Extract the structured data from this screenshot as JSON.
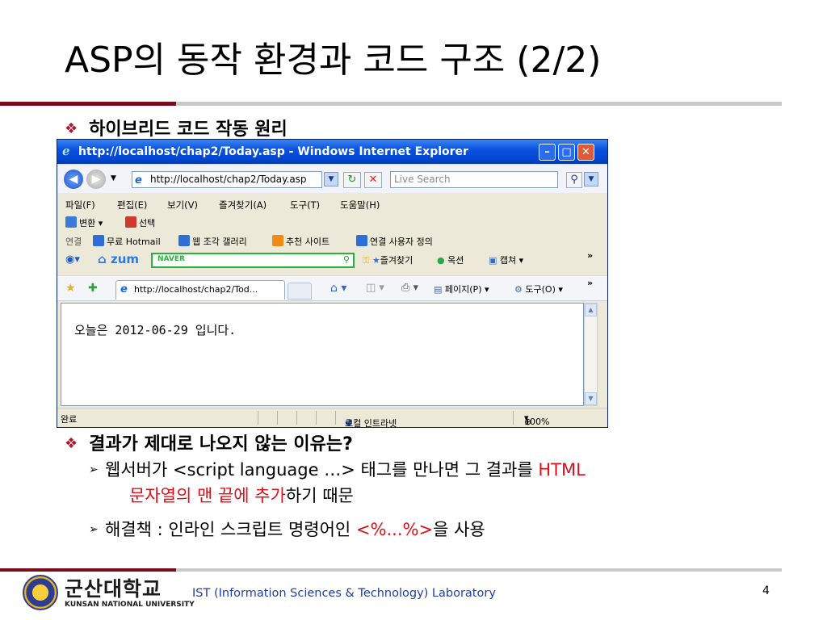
{
  "slide": {
    "title": "ASP의 동작 환경과 코드 구조 (2/2)",
    "bullets": [
      {
        "text": "하이브리드 코드 작동 원리"
      },
      {
        "text": "결과가 제대로 나오지 않는 이유는?"
      }
    ],
    "sub": {
      "line1_prefix": "웹서버가 <script language …> 태그를 만나면 그 결과를 ",
      "line1_red": "HTML",
      "line2_red": "문자열의 맨 끝에 추가",
      "line2_suffix": "하기 때문",
      "line3_prefix": "해결책 : 인라인 스크립트 명령어인 ",
      "line3_red": "<%...%>",
      "line3_suffix": "을 사용"
    }
  },
  "browser": {
    "title": "http://localhost/chap2/Today.asp - Windows Internet Explorer",
    "address": "http://localhost/chap2/Today.asp",
    "search_placeholder": "Live Search",
    "menu": [
      "파일(F)",
      "편집(E)",
      "보기(V)",
      "즐겨찾기(A)",
      "도구(T)",
      "도움말(H)"
    ],
    "translate": [
      "변환",
      "선택"
    ],
    "links": {
      "label": "연결",
      "items": [
        "무료 Hotmail",
        "웹 조각 갤러리",
        "추천 사이트",
        "연결 사용자 정의"
      ]
    },
    "zum": {
      "logo": "zum",
      "naver": "NAVER",
      "items": [
        "즐겨찾기",
        "옥션",
        "캡쳐"
      ]
    },
    "tab": "http://localhost/chap2/Tod...",
    "fav_tools": [
      "페이지(P)",
      "도구(O)"
    ],
    "content": "오늘은 2012-06-29 입니다.",
    "status": {
      "left": "완료",
      "zone": "로컬 인트라넷",
      "zoom": "100%"
    }
  },
  "footer": {
    "univ_ko": "군산대학교",
    "univ_en": "KUNSAN NATIONAL UNIVERSITY",
    "lab": "IST (Information Sciences & Technology) Laboratory",
    "page": "4"
  }
}
